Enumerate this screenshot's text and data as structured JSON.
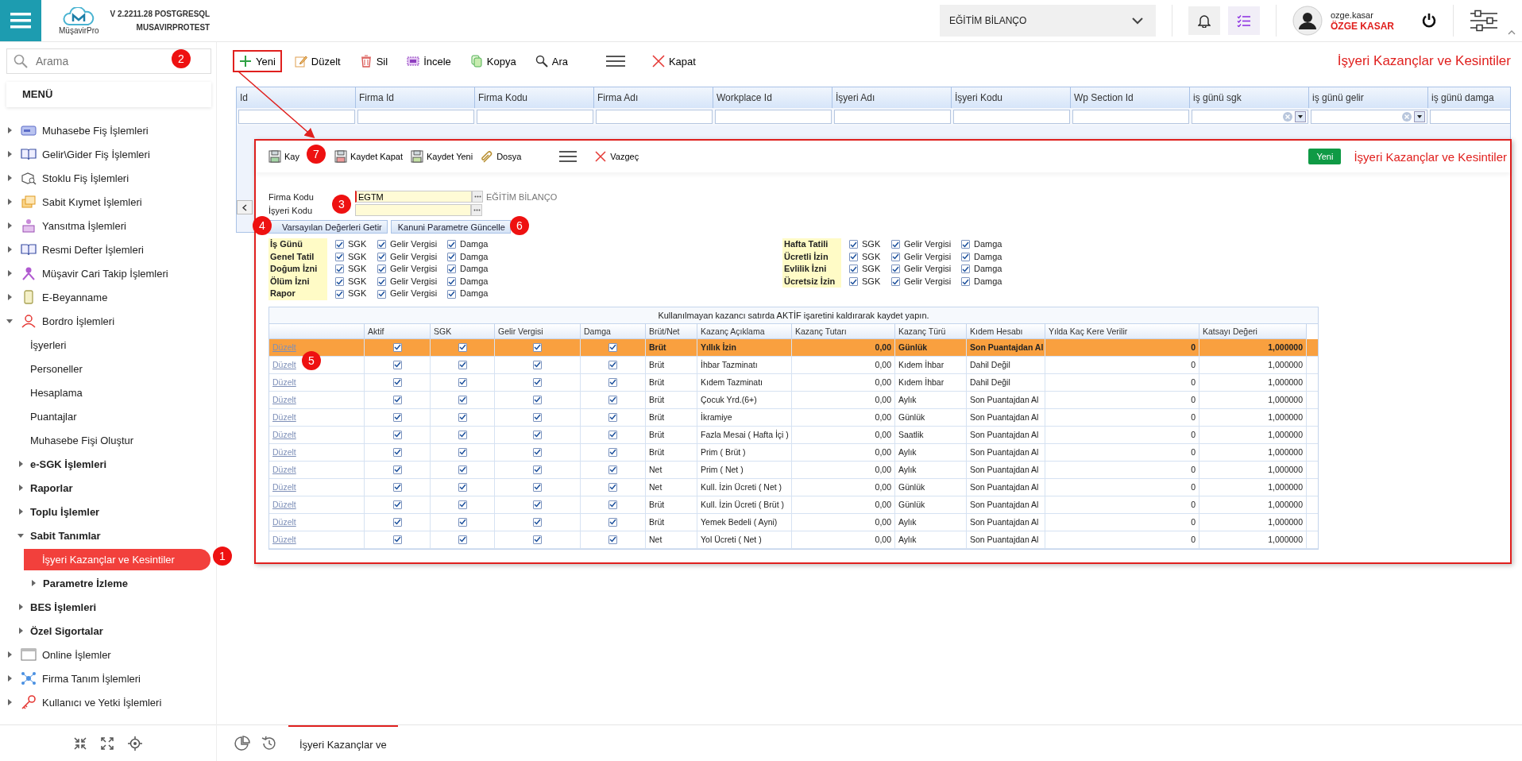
{
  "header": {
    "logo_text": "MüşavirPro",
    "version": "V 2.2211.28 POSTGRESQL",
    "server": "MUSAVIRPROTEST",
    "company_select": "EĞİTİM BİLANÇO",
    "user_login": "ozge.kasar",
    "user_name": "ÖZGE KASAR"
  },
  "sidebar": {
    "search_placeholder": "Arama",
    "menu_title": "MENÜ",
    "items": [
      {
        "label": "Muhasebe Fiş İşlemleri",
        "expanded": false
      },
      {
        "label": "Gelir\\Gider Fiş İşlemleri",
        "expanded": false
      },
      {
        "label": "Stoklu Fiş İşlemleri",
        "expanded": false
      },
      {
        "label": "Sabit Kıymet İşlemleri",
        "expanded": false
      },
      {
        "label": "Yansıtma İşlemleri",
        "expanded": false
      },
      {
        "label": "Resmi Defter İşlemleri",
        "expanded": false
      },
      {
        "label": "Müşavir Cari Takip İşlemleri",
        "expanded": false
      },
      {
        "label": "E-Beyanname",
        "expanded": false
      },
      {
        "label": "Bordro İşlemleri",
        "expanded": true,
        "children": [
          {
            "label": "İşyerleri",
            "selected": false
          },
          {
            "label": "Personeller",
            "selected": false
          },
          {
            "label": "Hesaplama",
            "selected": false
          },
          {
            "label": "Puantajlar",
            "selected": false
          },
          {
            "label": "Muhasebe Fişi Oluştur",
            "selected": false
          },
          {
            "label": "e-SGK İşlemleri",
            "expanded": false
          },
          {
            "label": "Raporlar",
            "expanded": false
          },
          {
            "label": "Toplu İşlemler",
            "expanded": false
          },
          {
            "label": "Sabit Tanımlar",
            "expanded": true,
            "children": [
              {
                "label": "İşyeri Kazançlar ve Kesintiler",
                "selected": true
              },
              {
                "label": "Parametre İzleme",
                "expanded": false
              }
            ]
          },
          {
            "label": "BES İşlemleri",
            "expanded": false
          },
          {
            "label": "Özel Sigortalar",
            "expanded": false
          }
        ]
      },
      {
        "label": "Online İşlemler",
        "expanded": false
      },
      {
        "label": "Firma Tanım İşlemleri",
        "expanded": false
      },
      {
        "label": "Kullanıcı ve Yetki İşlemleri",
        "expanded": false
      }
    ]
  },
  "toolbar": {
    "buttons": [
      {
        "kind": "new",
        "label": "Yeni",
        "highlighted": true
      },
      {
        "kind": "edit",
        "label": "Düzelt",
        "highlighted": false
      },
      {
        "kind": "delete",
        "label": "Sil",
        "highlighted": false
      },
      {
        "kind": "inspect",
        "label": "İncele",
        "highlighted": false
      },
      {
        "kind": "copy",
        "label": "Kopya",
        "highlighted": false
      },
      {
        "kind": "search",
        "label": "Ara",
        "highlighted": false
      },
      {
        "kind": "menu"
      },
      {
        "kind": "close",
        "label": "Kapat",
        "highlighted": false
      }
    ],
    "page_title": "İşyeri Kazançlar ve Kesintiler"
  },
  "grid": {
    "columns": [
      {
        "label": "Id",
        "kind": "text"
      },
      {
        "label": "Firma Id",
        "kind": "text"
      },
      {
        "label": "Firma Kodu",
        "kind": "text"
      },
      {
        "label": "Firma Adı",
        "kind": "text"
      },
      {
        "label": "Workplace Id",
        "kind": "text"
      },
      {
        "label": "İşyeri Adı",
        "kind": "text"
      },
      {
        "label": "İşyeri Kodu",
        "kind": "text"
      },
      {
        "label": "Wp Section Id",
        "kind": "text"
      },
      {
        "label": "iş günü sgk",
        "kind": "combo"
      },
      {
        "label": "iş günü gelir",
        "kind": "combo"
      },
      {
        "label": "iş günü damga",
        "kind": "text"
      }
    ]
  },
  "dialog": {
    "toolbar": [
      {
        "kind": "save",
        "label": "Kay"
      },
      {
        "kind": "save-close",
        "label": "Kaydet Kapat"
      },
      {
        "kind": "save-new",
        "label": "Kaydet Yeni"
      },
      {
        "kind": "file",
        "label": "Dosya"
      },
      {
        "kind": "menu"
      },
      {
        "kind": "cancel",
        "label": "Vazgeç"
      }
    ],
    "mode_badge": "Yeni",
    "title": "İşyeri Kazançlar ve Kesintiler",
    "fields": [
      {
        "label": "Firma Kodu",
        "value": "EGTM",
        "note": "EĞİTİM BİLANÇO"
      },
      {
        "label": "İşyeri Kodu"
      }
    ],
    "buttons": [
      "Varsayılan Değerleri Getir",
      "Kanuni Parametre Güncelle"
    ],
    "checks_left": [
      {
        "label": "İş Günü",
        "options": [
          {
            "label": "SGK",
            "checked": true
          },
          {
            "label": "Gelir Vergisi",
            "checked": true
          },
          {
            "label": "Damga",
            "checked": true
          }
        ]
      },
      {
        "label": "Genel Tatil",
        "options": [
          {
            "label": "SGK",
            "checked": true
          },
          {
            "label": "Gelir Vergisi",
            "checked": true
          },
          {
            "label": "Damga",
            "checked": true
          }
        ]
      },
      {
        "label": "Doğum İzni",
        "options": [
          {
            "label": "SGK",
            "checked": true
          },
          {
            "label": "Gelir Vergisi",
            "checked": true
          },
          {
            "label": "Damga",
            "checked": true
          }
        ]
      },
      {
        "label": "Ölüm İzni",
        "options": [
          {
            "label": "SGK",
            "checked": true
          },
          {
            "label": "Gelir Vergisi",
            "checked": true
          },
          {
            "label": "Damga",
            "checked": true
          }
        ]
      },
      {
        "label": "Rapor",
        "options": [
          {
            "label": "SGK",
            "checked": true
          },
          {
            "label": "Gelir Vergisi",
            "checked": true
          },
          {
            "label": "Damga",
            "checked": true
          }
        ]
      }
    ],
    "checks_right": [
      {
        "label": "Hafta Tatili",
        "options": [
          {
            "label": "SGK",
            "checked": true
          },
          {
            "label": "Gelir Vergisi",
            "checked": true
          },
          {
            "label": "Damga",
            "checked": true
          }
        ]
      },
      {
        "label": "Ücretli İzin",
        "options": [
          {
            "label": "SGK",
            "checked": true
          },
          {
            "label": "Gelir Vergisi",
            "checked": true
          },
          {
            "label": "Damga",
            "checked": true
          }
        ]
      },
      {
        "label": "Evlilik İzni",
        "options": [
          {
            "label": "SGK",
            "checked": true
          },
          {
            "label": "Gelir Vergisi",
            "checked": true
          },
          {
            "label": "Damga",
            "checked": true
          }
        ]
      },
      {
        "label": "Ücretsiz İzin",
        "options": [
          {
            "label": "SGK",
            "checked": true
          },
          {
            "label": "Gelir Vergisi",
            "checked": true
          },
          {
            "label": "Damga",
            "checked": true
          }
        ]
      }
    ],
    "table": {
      "notice": "Kullanılmayan kazancı satırda AKTİF işaretini kaldırarak kaydet yapın.",
      "columns": [
        "Aktif",
        "SGK",
        "Gelir Vergisi",
        "Damga",
        "Brüt/Net",
        "Kazanç Açıklama",
        "Kazanç Tutarı",
        "Kazanç Türü",
        "Kıdem Hesabı",
        "Yılda Kaç Kere Verilir",
        "Katsayı Değeri"
      ],
      "rows": [
        {
          "action": "Düzelt",
          "aktif": true,
          "sgk": true,
          "gelir_vergisi": true,
          "damga": true,
          "brut_net": "Brüt",
          "aciklama": "Yıllık İzin",
          "tutar": "0,00",
          "tur": "Günlük",
          "kidem": "Son Puantajdan Al",
          "yilda": "0",
          "katsayi": "1,000000",
          "selected": true
        },
        {
          "action": "Düzelt",
          "aktif": true,
          "sgk": true,
          "gelir_vergisi": true,
          "damga": true,
          "brut_net": "Brüt",
          "aciklama": "İhbar Tazminatı",
          "tutar": "0,00",
          "tur": "Kıdem İhbar",
          "kidem": "Dahil Değil",
          "yilda": "0",
          "katsayi": "1,000000",
          "selected": false
        },
        {
          "action": "Düzelt",
          "aktif": true,
          "sgk": true,
          "gelir_vergisi": true,
          "damga": true,
          "brut_net": "Brüt",
          "aciklama": "Kıdem Tazminatı",
          "tutar": "0,00",
          "tur": "Kıdem İhbar",
          "kidem": "Dahil Değil",
          "yilda": "0",
          "katsayi": "1,000000",
          "selected": false
        },
        {
          "action": "Düzelt",
          "aktif": true,
          "sgk": true,
          "gelir_vergisi": true,
          "damga": true,
          "brut_net": "Brüt",
          "aciklama": "Çocuk Yrd.(6+)",
          "tutar": "0,00",
          "tur": "Aylık",
          "kidem": "Son Puantajdan Al",
          "yilda": "0",
          "katsayi": "1,000000",
          "selected": false
        },
        {
          "action": "Düzelt",
          "aktif": true,
          "sgk": true,
          "gelir_vergisi": true,
          "damga": true,
          "brut_net": "Brüt",
          "aciklama": "İkramiye",
          "tutar": "0,00",
          "tur": "Günlük",
          "kidem": "Son Puantajdan Al",
          "yilda": "0",
          "katsayi": "1,000000",
          "selected": false
        },
        {
          "action": "Düzelt",
          "aktif": true,
          "sgk": true,
          "gelir_vergisi": true,
          "damga": true,
          "brut_net": "Brüt",
          "aciklama": "Fazla Mesai ( Hafta İçi )",
          "tutar": "0,00",
          "tur": "Saatlik",
          "kidem": "Son Puantajdan Al",
          "yilda": "0",
          "katsayi": "1,000000",
          "selected": false
        },
        {
          "action": "Düzelt",
          "aktif": true,
          "sgk": true,
          "gelir_vergisi": true,
          "damga": true,
          "brut_net": "Brüt",
          "aciklama": "Prim ( Brüt )",
          "tutar": "0,00",
          "tur": "Aylık",
          "kidem": "Son Puantajdan Al",
          "yilda": "0",
          "katsayi": "1,000000",
          "selected": false
        },
        {
          "action": "Düzelt",
          "aktif": true,
          "sgk": true,
          "gelir_vergisi": true,
          "damga": true,
          "brut_net": "Net",
          "aciklama": "Prim ( Net )",
          "tutar": "0,00",
          "tur": "Aylık",
          "kidem": "Son Puantajdan Al",
          "yilda": "0",
          "katsayi": "1,000000",
          "selected": false
        },
        {
          "action": "Düzelt",
          "aktif": true,
          "sgk": true,
          "gelir_vergisi": true,
          "damga": true,
          "brut_net": "Net",
          "aciklama": "Kull. İzin Ücreti ( Net )",
          "tutar": "0,00",
          "tur": "Günlük",
          "kidem": "Son Puantajdan Al",
          "yilda": "0",
          "katsayi": "1,000000",
          "selected": false
        },
        {
          "action": "Düzelt",
          "aktif": true,
          "sgk": true,
          "gelir_vergisi": true,
          "damga": true,
          "brut_net": "Brüt",
          "aciklama": "Kull. İzin Ücreti ( Brüt )",
          "tutar": "0,00",
          "tur": "Günlük",
          "kidem": "Son Puantajdan Al",
          "yilda": "0",
          "katsayi": "1,000000",
          "selected": false
        },
        {
          "action": "Düzelt",
          "aktif": true,
          "sgk": true,
          "gelir_vergisi": true,
          "damga": true,
          "brut_net": "Brüt",
          "aciklama": "Yemek Bedeli ( Ayni)",
          "tutar": "0,00",
          "tur": "Aylık",
          "kidem": "Son Puantajdan Al",
          "yilda": "0",
          "katsayi": "1,000000",
          "selected": false
        },
        {
          "action": "Düzelt",
          "aktif": true,
          "sgk": true,
          "gelir_vergisi": true,
          "damga": true,
          "brut_net": "Net",
          "aciklama": "Yol Ücreti ( Net )",
          "tutar": "0,00",
          "tur": "Aylık",
          "kidem": "Son Puantajdan Al",
          "yilda": "0",
          "katsayi": "1,000000",
          "selected": false
        }
      ]
    }
  },
  "bottom_bar": {
    "tabs": [
      {
        "label": "İşyeri Kazançlar ve",
        "selected": true
      }
    ]
  },
  "annotations": [
    "1",
    "2",
    "3",
    "4",
    "5",
    "6",
    "7"
  ]
}
